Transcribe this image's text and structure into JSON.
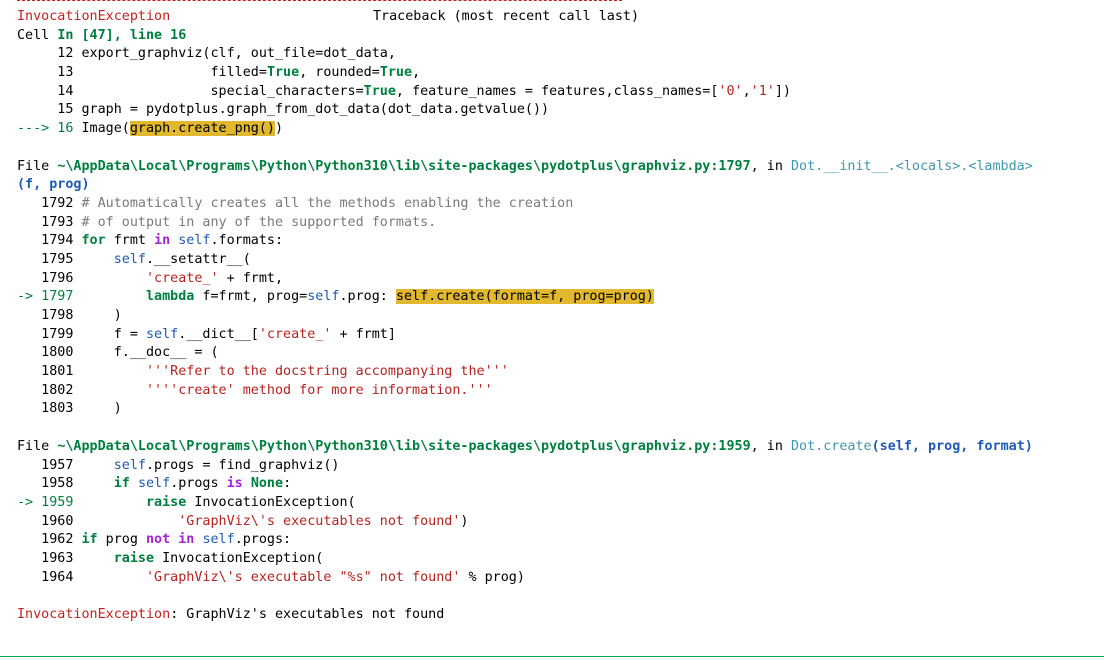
{
  "traceback": {
    "exception_name": "InvocationException",
    "header_right": "Traceback (most recent call last)",
    "cell_prefix": "Cell ",
    "cell_loc": "In [47], line 16",
    "file1_prefix": "File ",
    "file1_path": "~\\AppData\\Local\\Programs\\Python\\Python310\\lib\\site-packages\\pydotplus\\graphviz.py:1797",
    "file1_in": ", in ",
    "file1_func": "Dot.__init__.<locals>.<lambda>",
    "file1_args": "(f, prog)",
    "file2_path": "~\\AppData\\Local\\Programs\\Python\\Python310\\lib\\site-packages\\pydotplus\\graphviz.py:1959",
    "file2_func": "Dot.create",
    "file2_args": "(self, prog, format)",
    "final_exception": "InvocationException",
    "final_message": ": GraphViz's executables not found"
  },
  "block1": [
    [
      [
        "     12 ",
        ""
      ],
      [
        "export_graphviz(clf, out_file=dot_data,",
        ""
      ]
    ],
    [
      [
        "     13 ",
        ""
      ],
      [
        "                filled",
        ""
      ],
      [
        "=",
        ""
      ],
      [
        "True",
        "kw"
      ],
      [
        ", rounded",
        ""
      ],
      [
        "=",
        ""
      ],
      [
        "True",
        "kw"
      ],
      [
        ",",
        ""
      ]
    ],
    [
      [
        "     14 ",
        ""
      ],
      [
        "                special_characters",
        ""
      ],
      [
        "=",
        ""
      ],
      [
        "True",
        "kw"
      ],
      [
        ", feature_names ",
        ""
      ],
      [
        "=",
        ""
      ],
      [
        " features,class_names",
        ""
      ],
      [
        "=",
        ""
      ],
      [
        "[",
        ""
      ],
      [
        "'0'",
        "str"
      ],
      [
        ",",
        ""
      ],
      [
        "'1'",
        "str"
      ],
      [
        "])",
        ""
      ]
    ],
    [
      [
        "     15 ",
        ""
      ],
      [
        "graph ",
        ""
      ],
      [
        "=",
        ""
      ],
      [
        " pydotplus",
        ""
      ],
      [
        ".",
        ""
      ],
      [
        "graph_from_dot_data(dot_data",
        ""
      ],
      [
        ".",
        ""
      ],
      [
        "getvalue())",
        ""
      ]
    ],
    [
      [
        "---> 16 ",
        "grn"
      ],
      [
        "Image(",
        ""
      ],
      [
        "graph.create_png()",
        "hl"
      ],
      [
        ")",
        ""
      ]
    ]
  ],
  "block2": [
    [
      [
        "   1792 ",
        ""
      ],
      [
        "# Automatically creates all the methods enabling the creation",
        "com"
      ]
    ],
    [
      [
        "   1793 ",
        ""
      ],
      [
        "# of output in any of the supported formats.",
        "com"
      ]
    ],
    [
      [
        "   1794 ",
        ""
      ],
      [
        "for",
        "kw"
      ],
      [
        " frmt ",
        ""
      ],
      [
        "in",
        "ow"
      ],
      [
        " ",
        ""
      ],
      [
        "self",
        "sf"
      ],
      [
        ".formats:",
        ""
      ]
    ],
    [
      [
        "   1795 ",
        ""
      ],
      [
        "    ",
        ""
      ],
      [
        "self",
        "sf"
      ],
      [
        ".__setattr__(",
        ""
      ]
    ],
    [
      [
        "   1796 ",
        ""
      ],
      [
        "        ",
        ""
      ],
      [
        "'create_'",
        "str"
      ],
      [
        " + frmt,",
        ""
      ]
    ],
    [
      [
        "-> 1797 ",
        "grn"
      ],
      [
        "        ",
        ""
      ],
      [
        "lambda",
        "kw"
      ],
      [
        " f=frmt, prog=",
        ""
      ],
      [
        "self",
        "sf"
      ],
      [
        ".prog: ",
        ""
      ],
      [
        "self.create(format=f, prog=prog)",
        "hl"
      ]
    ],
    [
      [
        "   1798 ",
        ""
      ],
      [
        "    )",
        ""
      ]
    ],
    [
      [
        "   1799 ",
        ""
      ],
      [
        "    f ",
        ""
      ],
      [
        "=",
        ""
      ],
      [
        " ",
        ""
      ],
      [
        "self",
        "sf"
      ],
      [
        ".__dict__[",
        ""
      ],
      [
        "'create_'",
        "str"
      ],
      [
        " + frmt]",
        ""
      ]
    ],
    [
      [
        "   1800 ",
        ""
      ],
      [
        "    f.__doc__ = (",
        ""
      ]
    ],
    [
      [
        "   1801 ",
        ""
      ],
      [
        "        ",
        ""
      ],
      [
        "'''Refer to the docstring accompanying the'''",
        "str"
      ]
    ],
    [
      [
        "   1802 ",
        ""
      ],
      [
        "        ",
        ""
      ],
      [
        "''''create' method for more information.'''",
        "str"
      ]
    ],
    [
      [
        "   1803 ",
        ""
      ],
      [
        "    )",
        ""
      ]
    ]
  ],
  "block3": [
    [
      [
        "   1957 ",
        ""
      ],
      [
        "    ",
        ""
      ],
      [
        "self",
        "sf"
      ],
      [
        ".progs ",
        ""
      ],
      [
        "=",
        ""
      ],
      [
        " find_graphviz()",
        ""
      ]
    ],
    [
      [
        "   1958 ",
        ""
      ],
      [
        "    ",
        ""
      ],
      [
        "if",
        "kw"
      ],
      [
        " ",
        ""
      ],
      [
        "self",
        "sf"
      ],
      [
        ".progs ",
        ""
      ],
      [
        "is",
        "ow"
      ],
      [
        " ",
        ""
      ],
      [
        "None",
        "kw"
      ],
      [
        ":",
        ""
      ]
    ],
    [
      [
        "-> 1959 ",
        "grn"
      ],
      [
        "        ",
        ""
      ],
      [
        "raise",
        "kw"
      ],
      [
        " InvocationException(",
        ""
      ]
    ],
    [
      [
        "   1960 ",
        ""
      ],
      [
        "            ",
        ""
      ],
      [
        "'GraphViz\\'s executables not found'",
        "str"
      ],
      [
        ")",
        ""
      ]
    ],
    [
      [
        "   1962 ",
        ""
      ],
      [
        "if",
        "kw"
      ],
      [
        " prog ",
        ""
      ],
      [
        "not",
        "ow"
      ],
      [
        " ",
        ""
      ],
      [
        "in",
        "ow"
      ],
      [
        " ",
        ""
      ],
      [
        "self",
        "sf"
      ],
      [
        ".progs:",
        ""
      ]
    ],
    [
      [
        "   1963 ",
        ""
      ],
      [
        "    ",
        ""
      ],
      [
        "raise",
        "kw"
      ],
      [
        " InvocationException(",
        ""
      ]
    ],
    [
      [
        "   1964 ",
        ""
      ],
      [
        "        ",
        ""
      ],
      [
        "'GraphViz\\'s executable \"%s\" not found'",
        "str"
      ],
      [
        " % prog)",
        ""
      ]
    ]
  ]
}
